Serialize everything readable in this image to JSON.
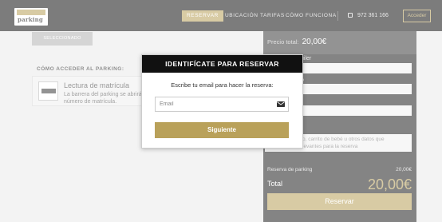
{
  "nav": {
    "logo_text": "parking",
    "items": [
      "RESERVAR",
      "UBICACIÓN",
      "TARIFAS",
      "CÓMO FUNCIONA"
    ],
    "phone": "972 361 166",
    "access_label": "Acceder"
  },
  "left": {
    "selected_pill": "SELECCIONADO",
    "access_title": "CÓMO ACCEDER AL PARKING:",
    "card": {
      "title": "Lectura de matrícula",
      "line1": "La barrera del parking se abrirá",
      "line2": "número de matrícula."
    }
  },
  "right": {
    "price_label": "Precio total:",
    "price_value": "20,00€",
    "field_labels": [
      "uiler",
      "culo"
    ],
    "textarea_line1": "o, carrito de bebé u otros datos que",
    "textarea_line2": "levantes para la reserva",
    "reserva_label": "Reserva de parking",
    "reserva_value": "20,00€",
    "total_label": "Total",
    "total_value": "20,00€",
    "button": "Reservar"
  },
  "modal": {
    "title": "IDENTIFÍCATE PARA RESERVAR",
    "label": "Escribe tu email para hacer la reserva:",
    "email_placeholder": "Email",
    "next_button": "Siguiente"
  },
  "colors": {
    "accent": "#b9a15a",
    "dark": "#111111"
  }
}
